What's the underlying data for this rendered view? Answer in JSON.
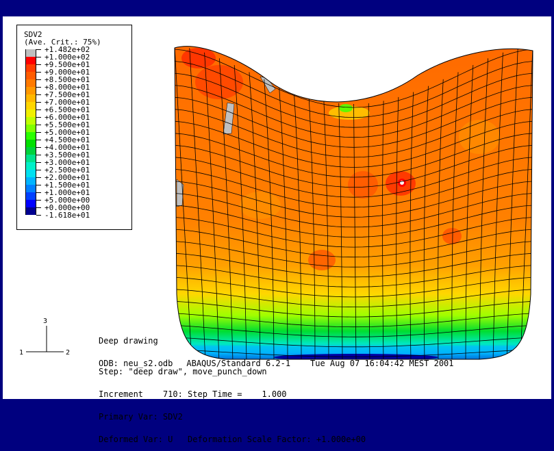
{
  "legend": {
    "variable": "SDV2",
    "averaging": "(Ave. Crit.: 75%)",
    "entries": [
      {
        "label": "+1.482e+02",
        "color": "#bfbfbf"
      },
      {
        "label": "+1.000e+02",
        "color": "#ff0000"
      },
      {
        "label": "+9.500e+01",
        "color": "#ff3d00"
      },
      {
        "label": "+9.000e+01",
        "color": "#ff5c00"
      },
      {
        "label": "+8.500e+01",
        "color": "#ff7a00"
      },
      {
        "label": "+8.000e+01",
        "color": "#ff9900"
      },
      {
        "label": "+7.500e+01",
        "color": "#ffb800"
      },
      {
        "label": "+7.000e+01",
        "color": "#ffd600"
      },
      {
        "label": "+6.500e+01",
        "color": "#f0f000"
      },
      {
        "label": "+6.000e+01",
        "color": "#bfff00"
      },
      {
        "label": "+5.500e+01",
        "color": "#80ff00"
      },
      {
        "label": "+5.000e+01",
        "color": "#2bff00"
      },
      {
        "label": "+4.500e+01",
        "color": "#00e000"
      },
      {
        "label": "+4.000e+01",
        "color": "#00d23c"
      },
      {
        "label": "+3.500e+01",
        "color": "#00e28c"
      },
      {
        "label": "+3.000e+01",
        "color": "#00f0c8"
      },
      {
        "label": "+2.500e+01",
        "color": "#00e0f0"
      },
      {
        "label": "+2.000e+01",
        "color": "#00b4ff"
      },
      {
        "label": "+1.500e+01",
        "color": "#0080ff"
      },
      {
        "label": "+1.000e+01",
        "color": "#0040ff"
      },
      {
        "label": "+5.000e+00",
        "color": "#0000ff"
      },
      {
        "label": "+0.000e+00",
        "color": "#000090"
      },
      {
        "label": "-1.618e+01",
        "color": "#444444"
      }
    ]
  },
  "triad": {
    "axis1": "1",
    "axis2": "2",
    "axis3": "3"
  },
  "info": {
    "title": "Deep drawing",
    "odb": "ODB: neu_s2.odb",
    "solver": "ABAQUS/Standard 6.2-1    Tue Aug 07 16:04:42 MEST 2001",
    "step": "Step: \"deep draw\", move_punch_down",
    "increment": "Increment    710: Step Time =    1.000",
    "primary": "Primary Var: SDV2",
    "deformed": "Deformed Var: U   Deformation Scale Factor: +1.000e+00"
  },
  "colors": {
    "frame": "#00007f",
    "viewport": "#ffffff",
    "mesh_lines": "#000000",
    "model_base": "#ff8c00"
  }
}
